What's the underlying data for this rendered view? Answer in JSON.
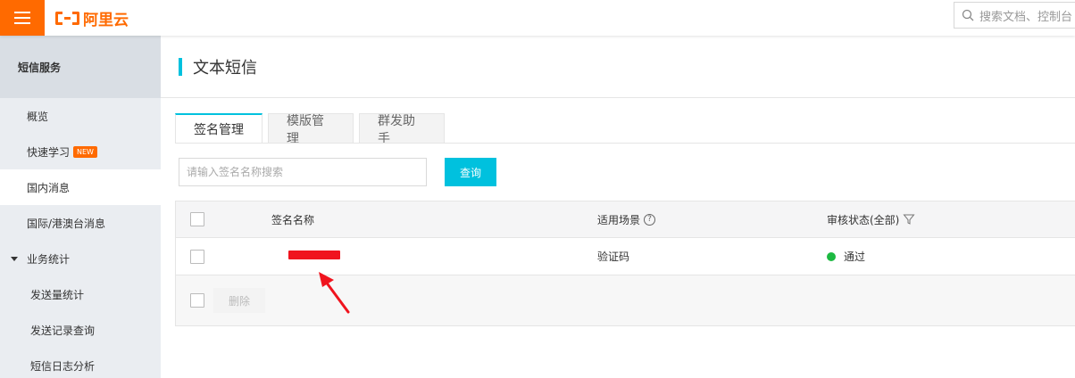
{
  "topbar": {
    "logo_text": "阿里云",
    "search_placeholder": "搜索文档、控制台"
  },
  "sidebar": {
    "header": "短信服务",
    "items": [
      {
        "label": "概览"
      },
      {
        "label": "快速学习",
        "badge": "NEW"
      },
      {
        "label": "国内消息",
        "active": true
      },
      {
        "label": "国际/港澳台消息"
      },
      {
        "label": "业务统计",
        "expanded": true
      },
      {
        "label": "发送量统计"
      },
      {
        "label": "发送记录查询"
      },
      {
        "label": "短信日志分析"
      }
    ]
  },
  "main": {
    "title": "文本短信",
    "tabs": [
      {
        "label": "签名管理",
        "active": true
      },
      {
        "label": "模版管理"
      },
      {
        "label": "群发助手"
      }
    ],
    "search": {
      "placeholder": "请输入签名名称搜索",
      "button": "查询"
    },
    "table": {
      "columns": [
        "签名名称",
        "适用场景",
        "审核状态(全部)"
      ],
      "rows": [
        {
          "name": "",
          "scene": "验证码",
          "status": "通过"
        }
      ],
      "delete_label": "删除"
    }
  },
  "colors": {
    "brand": "#ff6a00",
    "accent": "#00c1de",
    "status_ok": "#1cb941",
    "annotation": "#f0141e"
  }
}
